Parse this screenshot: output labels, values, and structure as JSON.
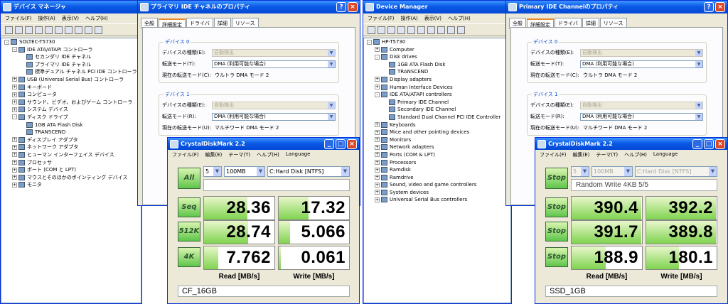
{
  "left_dm": {
    "title": "デバイス マネージャ",
    "menu": [
      "ファイル(F)",
      "操作(A)",
      "表示(V)",
      "ヘルプ(H)"
    ],
    "tree": [
      {
        "t": "SOLTEC-T5730",
        "lv": 0,
        "pm": "-"
      },
      {
        "t": "IDE ATA/ATAPI コントローラ",
        "lv": 1,
        "pm": "-"
      },
      {
        "t": "セカンダリ IDE チャネル",
        "lv": 2
      },
      {
        "t": "プライマリ IDE チャネル",
        "lv": 2
      },
      {
        "t": "標準デュアル チャネル PCI IDE コントローラ",
        "lv": 2
      },
      {
        "t": "USB (Universal Serial Bus) コントローラ",
        "lv": 1,
        "pm": "+"
      },
      {
        "t": "キーボード",
        "lv": 1,
        "pm": "+"
      },
      {
        "t": "コンピュータ",
        "lv": 1,
        "pm": "+"
      },
      {
        "t": "サウンド、ビデオ、およびゲーム コントローラ",
        "lv": 1,
        "pm": "+"
      },
      {
        "t": "システム デバイス",
        "lv": 1,
        "pm": "+"
      },
      {
        "t": "ディスク ドライブ",
        "lv": 1,
        "pm": "-"
      },
      {
        "t": "1GB ATA Flash Disk",
        "lv": 2
      },
      {
        "t": "TRANSCEND",
        "lv": 2
      },
      {
        "t": "ディスプレイ アダプタ",
        "lv": 1,
        "pm": "+"
      },
      {
        "t": "ネットワーク アダプタ",
        "lv": 1,
        "pm": "+"
      },
      {
        "t": "ヒューマン インターフェイス デバイス",
        "lv": 1,
        "pm": "+"
      },
      {
        "t": "プロセッサ",
        "lv": 1,
        "pm": "+"
      },
      {
        "t": "ポート (COM と LPT)",
        "lv": 1,
        "pm": "+"
      },
      {
        "t": "マウスとそのほかのポインティング デバイス",
        "lv": 1,
        "pm": "+"
      },
      {
        "t": "モニタ",
        "lv": 1,
        "pm": "+"
      }
    ]
  },
  "left_prop": {
    "title": "プライマリ IDE チャネルのプロパティ",
    "tabs": [
      "全般",
      "詳細設定",
      "ドライバ",
      "詳細",
      "リソース"
    ],
    "dev0": {
      "title": "デバイス 0",
      "l1": "デバイスの種類(E):",
      "v1": "自動検出",
      "l2": "転送モード(T):",
      "v2": "DMA (利用可能な場合)",
      "l3": "現在の転送モード(C):",
      "v3": "ウルトラ DMA モード 2"
    },
    "dev1": {
      "title": "デバイス 1",
      "l1": "デバイスの種類(E):",
      "v1": "自動検出",
      "l2": "転送モード(R):",
      "v2": "DMA (利用可能な場合)",
      "l3": "現在の転送モード(U):",
      "v3": "マルチワード DMA モード 2"
    }
  },
  "left_cdm": {
    "title": "CrystalDiskMark 2.2",
    "menu": [
      "ファイル(F)",
      "編集(E)",
      "テーマ(T)",
      "ヘルプ(H)",
      "Language"
    ],
    "count": "5",
    "size": "100MB",
    "drive": "C:Hard Disk [NTFS]",
    "all": "All",
    "status": "",
    "labels": [
      "Seq",
      "512K",
      "4K"
    ],
    "read": [
      "28.36",
      "28.74",
      "7.762"
    ],
    "write": [
      "17.32",
      "5.066",
      "0.061"
    ],
    "read_fill": [
      0.62,
      0.63,
      0.2
    ],
    "write_fill": [
      0.42,
      0.16,
      0.03
    ],
    "hread": "Read [MB/s]",
    "hwrite": "Write [MB/s]",
    "info": "CF_16GB"
  },
  "right_dm": {
    "title": "Device Manager",
    "menu": [
      "ファイル(F)",
      "操作(A)",
      "表示(V)",
      "ヘルプ(H)"
    ],
    "tree": [
      {
        "t": "HP-T5730",
        "lv": 0,
        "pm": "-"
      },
      {
        "t": "Computer",
        "lv": 1,
        "pm": "+"
      },
      {
        "t": "Disk drives",
        "lv": 1,
        "pm": "-"
      },
      {
        "t": "1GB ATA Flash Disk",
        "lv": 2
      },
      {
        "t": "TRANSCEND",
        "lv": 2
      },
      {
        "t": "Display adapters",
        "lv": 1,
        "pm": "+"
      },
      {
        "t": "Human Interface Devices",
        "lv": 1,
        "pm": "+"
      },
      {
        "t": "IDE ATA/ATAPI controllers",
        "lv": 1,
        "pm": "-"
      },
      {
        "t": "Primary IDE Channel",
        "lv": 2
      },
      {
        "t": "Secondary IDE Channel",
        "lv": 2
      },
      {
        "t": "Standard Dual Channel PCI IDE Controller",
        "lv": 2
      },
      {
        "t": "Keyboards",
        "lv": 1,
        "pm": "+"
      },
      {
        "t": "Mice and other pointing devices",
        "lv": 1,
        "pm": "+"
      },
      {
        "t": "Monitors",
        "lv": 1,
        "pm": "+"
      },
      {
        "t": "Network adapters",
        "lv": 1,
        "pm": "+"
      },
      {
        "t": "Ports (COM & LPT)",
        "lv": 1,
        "pm": "+"
      },
      {
        "t": "Processors",
        "lv": 1,
        "pm": "+"
      },
      {
        "t": "Ramdisk",
        "lv": 1,
        "pm": "+"
      },
      {
        "t": "Ramdrive",
        "lv": 1,
        "pm": "+"
      },
      {
        "t": "Sound, video and game controllers",
        "lv": 1,
        "pm": "+"
      },
      {
        "t": "System devices",
        "lv": 1,
        "pm": "+"
      },
      {
        "t": "Universal Serial Bus controllers",
        "lv": 1,
        "pm": "+"
      }
    ]
  },
  "right_prop": {
    "title": "Primary IDE Channelのプロパティ",
    "tabs": [
      "全般",
      "詳細設定",
      "ドライバ",
      "詳細",
      "リソース"
    ],
    "dev0": {
      "title": "デバイス 0",
      "l1": "デバイスの種類(E):",
      "v1": "自動検出",
      "l2": "転送モード(T):",
      "v2": "DMA (利用可能な場合)",
      "l3": "現在の転送モード(C):",
      "v3": "ウルトラ DMA モード 2"
    },
    "dev1": {
      "title": "デバイス 1",
      "l1": "デバイスの種類(E):",
      "v1": "自動検出",
      "l2": "転送モード(R):",
      "v2": "DMA (利用可能な場合)",
      "l3": "現在の転送モード(U):",
      "v3": "マルチワード DMA モード 2"
    }
  },
  "right_cdm": {
    "title": "CrystalDiskMark 2.2",
    "menu": [
      "ファイル(F)",
      "編集(E)",
      "テーマ(T)",
      "ヘルプ(H)",
      "Language"
    ],
    "count": "5",
    "size": "100MB",
    "drive": "C:Hard Disk [NTFS]",
    "all": "Stop",
    "status": "Random Write 4KB 5/5",
    "labels": [
      "Stop",
      "Stop",
      "Stop"
    ],
    "read": [
      "390.4",
      "391.7",
      "188.9"
    ],
    "write": [
      "392.2",
      "389.8",
      "180.1"
    ],
    "read_fill": [
      0.99,
      0.99,
      0.48
    ],
    "write_fill": [
      0.99,
      0.99,
      0.46
    ],
    "hread": "Read [MB/s]",
    "hwrite": "Write [MB/s]",
    "info": "SSD_1GB"
  }
}
